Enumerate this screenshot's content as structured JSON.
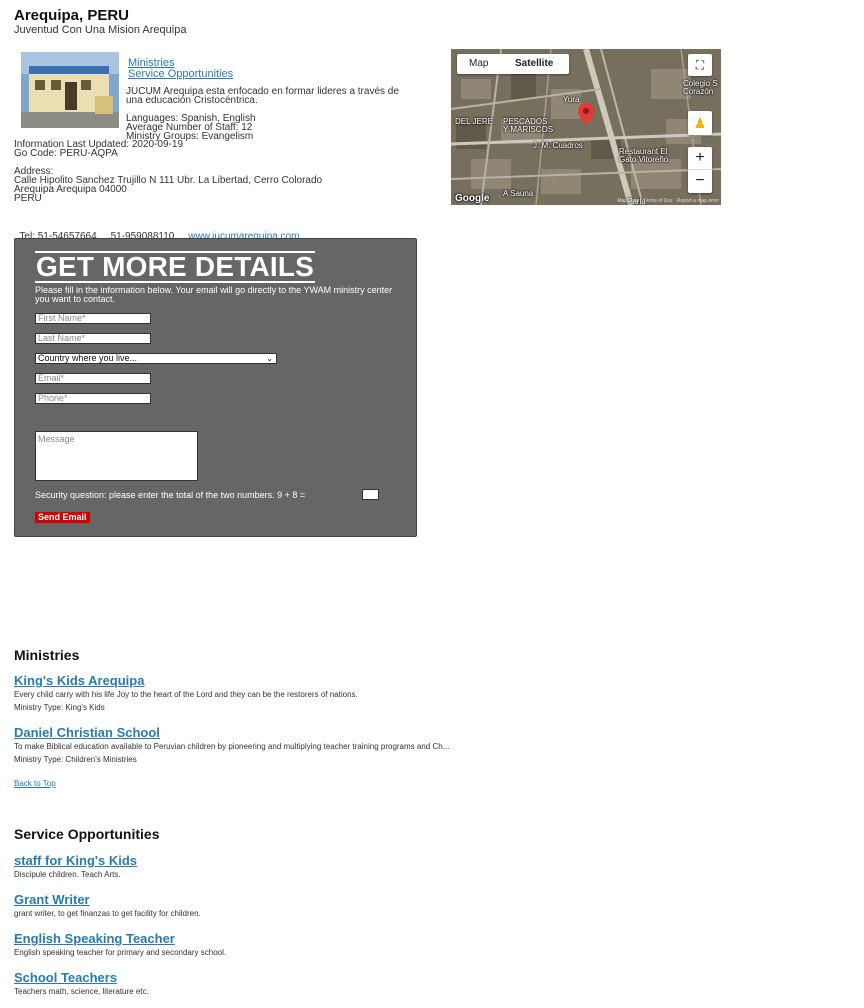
{
  "header": {
    "title": "Arequipa, PERU",
    "subtitle": "Juventud Con Una Mision Arequipa"
  },
  "links": {
    "ministries": "Ministries",
    "service_opportunities": "Service Opportunities"
  },
  "info": {
    "description": "JUCUM Arequipa esta enfocado en formar lideres a través de una educación Cristocéntrica.",
    "languages": "Languages: Spanish, English",
    "staff": "Average Number of Staff: 12",
    "groups": "Ministry Groups: Evangelism",
    "updated": "Information Last Updated: 2020-09-19",
    "gocode": "Go Code: PERU-AQPA"
  },
  "address": {
    "label": "Address:",
    "line1": "Calle Hipolito Sanchez Trujillo N 111 Ubr. La Libertad, Cerro Colorado",
    "line2": "Arequipa Arequipa 04000",
    "line3": "PERU"
  },
  "contact": {
    "tel_label": "Tel:",
    "tel1": "51-54657664",
    "tel2": "51-959088110",
    "website": "www.jucumarequipa.com"
  },
  "map": {
    "tab_map": "Map",
    "tab_satellite": "Satellite",
    "labels": [
      "Colegio S",
      "Corazón",
      "Yura",
      "DEL JERE",
      "PESCADOS",
      "Y MARISCOS",
      "J. M. Cuadros",
      "Restaurant El",
      "Gato Vitoreño",
      "A Sauna",
      "Parla"
    ],
    "footer": "Map Data   Terms of Use   Report a map error",
    "google": "Google"
  },
  "form": {
    "title": "GET MORE DETAILS",
    "description": "Please fill in the information below. Your email will go directly to the YWAM ministry center you want to contact.",
    "first_name": "First Name*",
    "last_name": "Last Name*",
    "country": "Country where you live...",
    "email": "Email*",
    "phone": "Phone*",
    "message": "Message",
    "security": "Security question: please enter the total of the two numbers. 9 + 8 =",
    "send": "Send Email"
  },
  "ministries": {
    "heading": "Ministries",
    "items": [
      {
        "title": "King's Kids Arequipa",
        "desc": "Every child carry with his life Joy to the heart of the Lord and they can be the restorers of nations.",
        "type": "Ministry Type: King's Kids"
      },
      {
        "title": "Daniel Christian School",
        "desc": "To make Biblical education available to Peruvian children by pioneering and multiplying teacher training programs and Ch...",
        "type": "Ministry Type: Children's Ministries"
      }
    ],
    "back_to_top": "Back to Top"
  },
  "service": {
    "heading": "Service Opportunities",
    "items": [
      {
        "title": "staff for King's Kids",
        "desc": "Discipule children. Teach Arts."
      },
      {
        "title": "Grant Writer",
        "desc": "grant writer, to get finanzas to get facility for children."
      },
      {
        "title": "English Speaking Teacher",
        "desc": "English speaking teacher for primary and secondary school."
      },
      {
        "title": "School Teachers",
        "desc": "Teachers math, science, literature etc."
      }
    ]
  }
}
